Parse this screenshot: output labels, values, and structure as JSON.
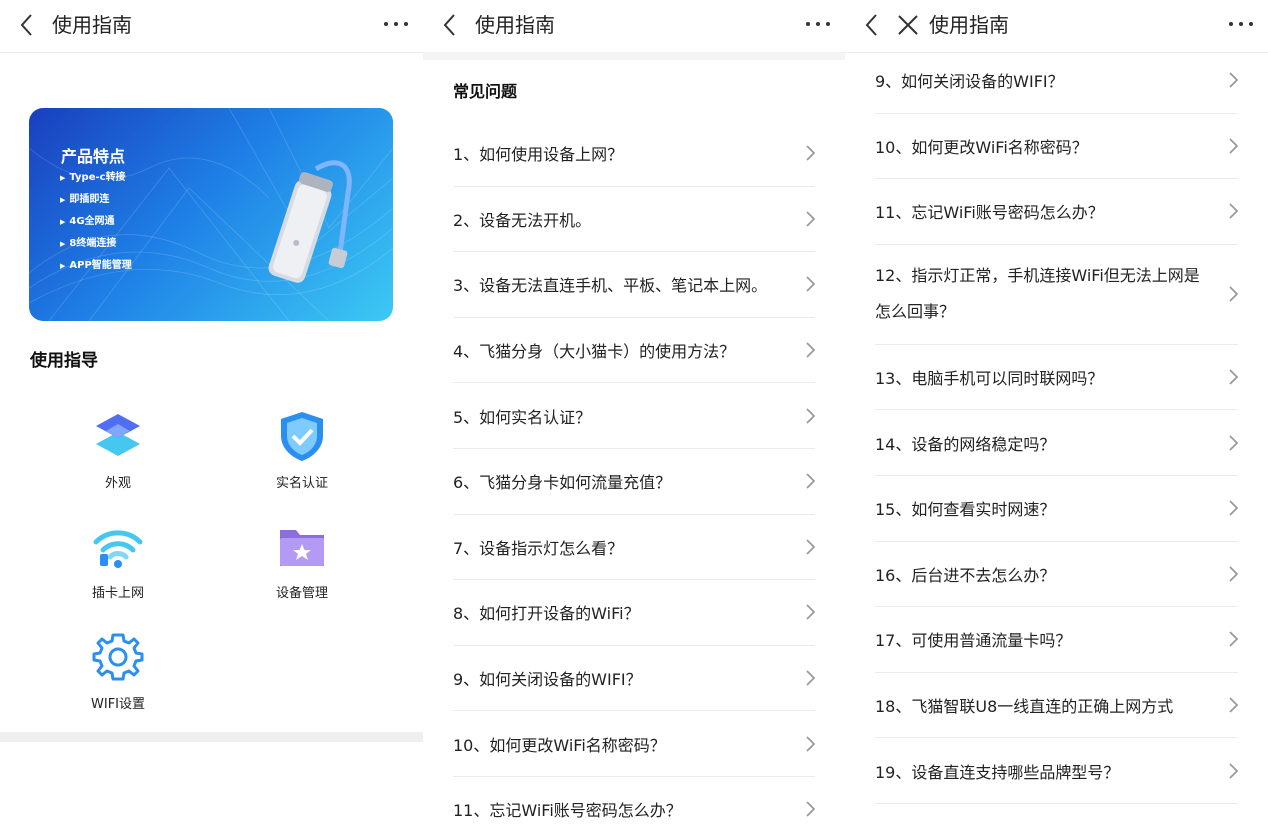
{
  "panels": [
    {
      "title": "使用指南",
      "banner": {
        "title": "产品特点",
        "features": [
          "Type-c转接",
          "即插即连",
          "4G全网通",
          "8终端连接",
          "APP智能管理"
        ]
      },
      "guide_title": "使用指导",
      "guide_items": [
        {
          "label": "外观",
          "icon": "layers-icon"
        },
        {
          "label": "实名认证",
          "icon": "shield-check-icon"
        },
        {
          "label": "插卡上网",
          "icon": "wifi-icon"
        },
        {
          "label": "设备管理",
          "icon": "folder-star-icon"
        },
        {
          "label": "WIFI设置",
          "icon": "gear-icon"
        }
      ]
    },
    {
      "title": "使用指南",
      "section_title": "常见问题",
      "items": [
        "1、如何使用设备上网？",
        "2、设备无法开机。",
        "3、设备无法直连手机、平板、笔记本上网。",
        "4、飞猫分身（大小猫卡）的使用方法？",
        "5、如何实名认证？",
        "6、飞猫分身卡如何流量充值？",
        "7、设备指示灯怎么看？",
        "8、如何打开设备的WiFi？",
        "9、如何关闭设备的WIFI？",
        "10、如何更改WiFi名称密码？",
        "11、忘记WiFi账号密码怎么办？"
      ]
    },
    {
      "title": "使用指南",
      "items": [
        "9、如何关闭设备的WIFI？",
        "10、如何更改WiFi名称密码？",
        "11、忘记WiFi账号密码怎么办？",
        "12、指示灯正常，手机连接WiFi但无法上网是怎么回事？",
        "13、电脑手机可以同时联网吗？",
        "14、设备的网络稳定吗？",
        "15、如何查看实时网速？",
        "16、后台进不去怎么办？",
        "17、可使用普通流量卡吗？",
        "18、飞猫智联U8一线直连的正确上网方式",
        "19、设备直连支持哪些品牌型号？"
      ]
    }
  ],
  "colors": {
    "accent": "#2b8ff0",
    "purple": "#8a6ee0",
    "divider": "#ebebeb"
  }
}
